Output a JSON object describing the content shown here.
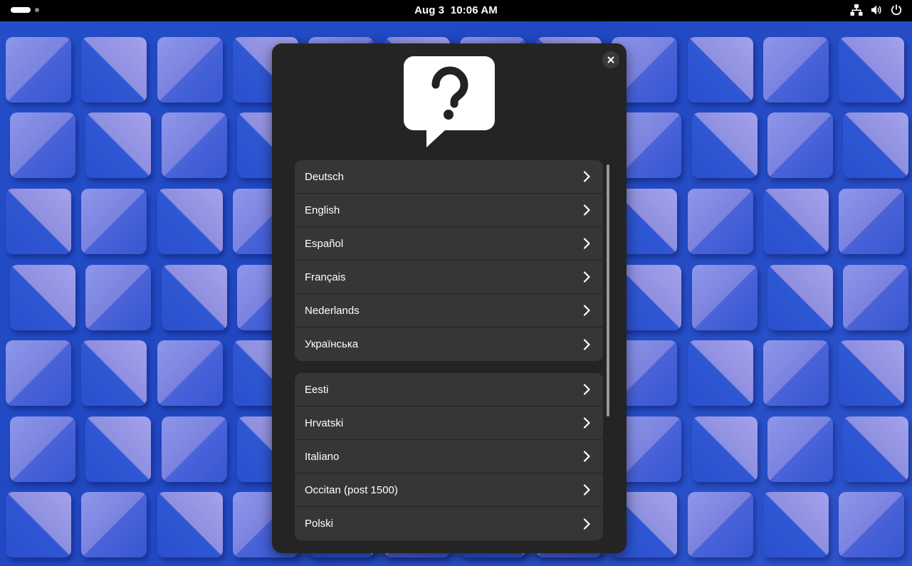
{
  "topbar": {
    "date": "Aug 3",
    "time": "10:06 AM",
    "tray_icons": [
      "network-wired-icon",
      "volume-icon",
      "power-icon"
    ]
  },
  "dialog": {
    "icon": "help-question-bubble-icon",
    "close_icon": "close-icon",
    "primary_languages": [
      {
        "label": "Deutsch"
      },
      {
        "label": "English"
      },
      {
        "label": "Español"
      },
      {
        "label": "Français"
      },
      {
        "label": "Nederlands"
      },
      {
        "label": "Українська"
      }
    ],
    "other_languages": [
      {
        "label": "Eesti"
      },
      {
        "label": "Hrvatski"
      },
      {
        "label": "Italiano"
      },
      {
        "label": "Occitan (post 1500)"
      },
      {
        "label": "Polski"
      }
    ]
  },
  "colors": {
    "dialog_bg": "#242424",
    "row_bg": "#363636",
    "topbar_bg": "#000000",
    "wallpaper_base": "#2148c2"
  }
}
